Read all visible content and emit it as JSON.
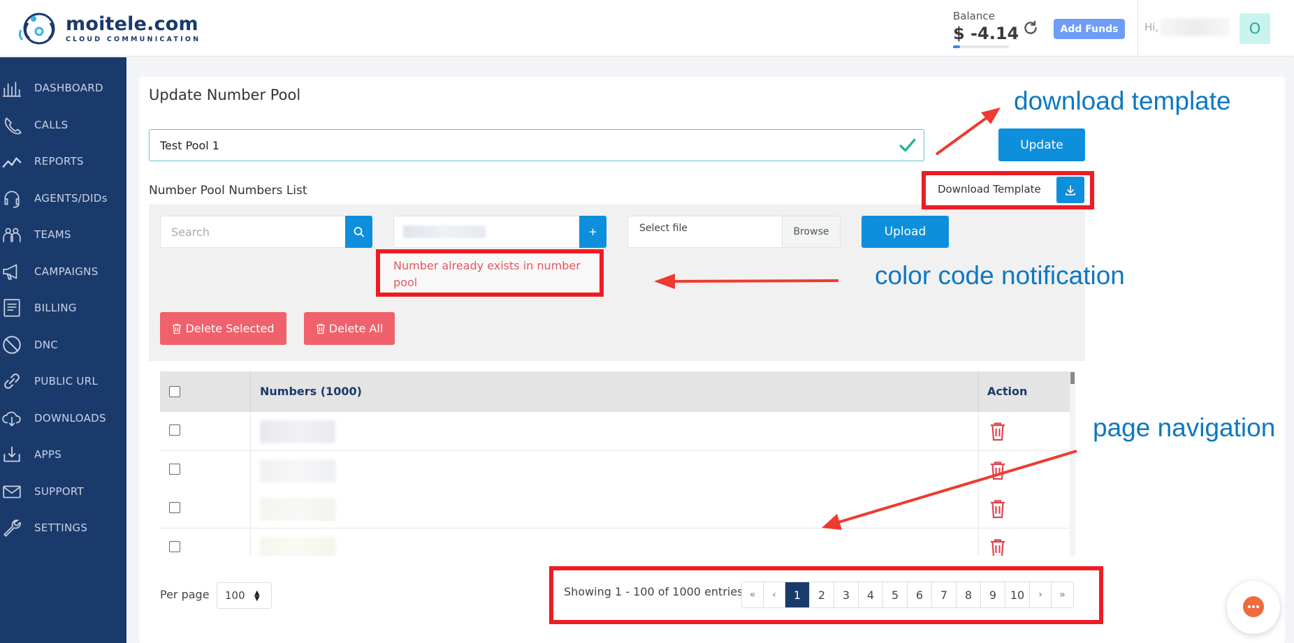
{
  "brand": {
    "name": "moitele.com",
    "tagline": "CLOUD COMMUNICATION"
  },
  "header": {
    "balance_label": "Balance",
    "balance_value": "$ -4.14",
    "add_funds_label": "Add Funds",
    "greeting": "Hi,",
    "avatar_initial": "O"
  },
  "sidebar": {
    "items": [
      {
        "label": "DASHBOARD",
        "icon": "dashboard-icon"
      },
      {
        "label": "CALLS",
        "icon": "calls-icon"
      },
      {
        "label": "REPORTS",
        "icon": "reports-icon"
      },
      {
        "label": "AGENTS/DIDs",
        "icon": "headset-icon"
      },
      {
        "label": "TEAMS",
        "icon": "teams-icon"
      },
      {
        "label": "CAMPAIGNS",
        "icon": "megaphone-icon"
      },
      {
        "label": "BILLING",
        "icon": "billing-icon"
      },
      {
        "label": "DNC",
        "icon": "block-icon"
      },
      {
        "label": "PUBLIC URL",
        "icon": "link-icon"
      },
      {
        "label": "DOWNLOADS",
        "icon": "cloud-download-icon"
      },
      {
        "label": "APPS",
        "icon": "apps-icon"
      },
      {
        "label": "SUPPORT",
        "icon": "mail-icon"
      },
      {
        "label": "SETTINGS",
        "icon": "wrench-icon"
      }
    ]
  },
  "page": {
    "title": "Update Number Pool",
    "pool_name_value": "Test Pool 1",
    "update_label": "Update",
    "list_title": "Number Pool Numbers List",
    "download_template_label": "Download Template",
    "search_placeholder": "Search",
    "plus_label": "+",
    "file_placeholder": "Select file",
    "browse_label": "Browse",
    "upload_label": "Upload",
    "notice": "Number already exists in number pool",
    "delete_selected_label": "Delete Selected",
    "delete_all_label": "Delete All"
  },
  "table": {
    "columns": [
      "Numbers (1000)",
      "Action"
    ],
    "row_count_visible": 4
  },
  "footer": {
    "per_page_label": "Per page",
    "per_page_value": "100",
    "showing": "Showing 1 - 100 of 1000 entries",
    "pages": [
      "1",
      "2",
      "3",
      "4",
      "5",
      "6",
      "7",
      "8",
      "9",
      "10"
    ],
    "first": "«",
    "prev": "‹",
    "next": "›",
    "last": "»",
    "active_page": "1"
  },
  "annotations": {
    "download": "download template",
    "color_code": "color code notification",
    "page_nav": "page navigation"
  },
  "colors": {
    "sidebar": "#1b3a6c",
    "primary": "#0e8fdc",
    "danger": "#f0616c",
    "annotation_red": "#ee1c25",
    "annotation_text": "#0d78c2"
  }
}
